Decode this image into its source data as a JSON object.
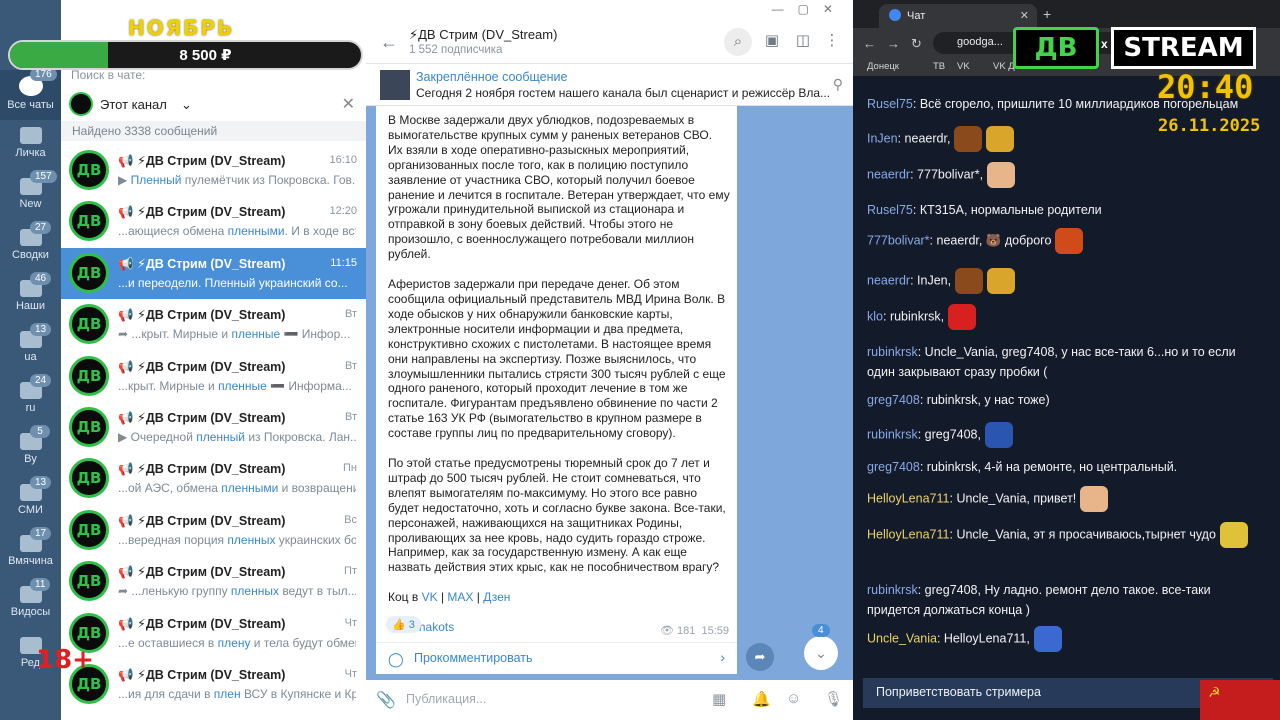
{
  "promo": {
    "month": "НОЯБРЬ",
    "amount": "8 500 ₽",
    "progress": 0.28
  },
  "age_badge": "18+",
  "rail": [
    {
      "label": "Все чаты",
      "badge": "176"
    },
    {
      "label": "Личка",
      "badge": ""
    },
    {
      "label": "New",
      "badge": "157"
    },
    {
      "label": "Сводки",
      "badge": "27"
    },
    {
      "label": "Наши",
      "badge": "46"
    },
    {
      "label": "ua",
      "badge": "13"
    },
    {
      "label": "ru",
      "badge": "24"
    },
    {
      "label": "By",
      "badge": "5"
    },
    {
      "label": "СМИ",
      "badge": "13"
    },
    {
      "label": "Вмячина",
      "badge": "17"
    },
    {
      "label": "Видосы",
      "badge": "11"
    },
    {
      "label": "Ред",
      "badge": ""
    }
  ],
  "chatlist": {
    "search_label": "Поиск в чате:",
    "filter": "Этот канал",
    "found": "Найдено 3338 сообщений",
    "rows": [
      {
        "name": "📢 ⚡ДВ Стрим (DV_Stream)",
        "time": "16:10",
        "pre": "▶ ",
        "hl": "Пленный",
        "post": " пулемётчик из Покровска. Гов..."
      },
      {
        "name": "📢 ⚡ДВ Стрим (DV_Stream)",
        "time": "12:20",
        "pre": "...ающиеся обмена ",
        "hl": "пленными",
        "post": ". И в ходе вст..."
      },
      {
        "name": "📢 ⚡ДВ Стрим (DV_Stream)",
        "time": "11:15",
        "pre": "...и переодели. ",
        "hl": "Пленный",
        "post": " украинский со..."
      },
      {
        "name": "📢 ⚡ДВ Стрим (DV_Stream)",
        "time": "Вт",
        "pre": "➦ ...крыт. Мирные и ",
        "hl": "пленные",
        "post": " ➖ Инфор..."
      },
      {
        "name": "📢 ⚡ДВ Стрим (DV_Stream)",
        "time": "Вт",
        "pre": "...крыт. Мирные и ",
        "hl": "пленные",
        "post": " ➖ Информа..."
      },
      {
        "name": "📢 ⚡ДВ Стрим (DV_Stream)",
        "time": "Вт",
        "pre": "▶ Очередной ",
        "hl": "пленный",
        "post": " из Покровска. Лан..."
      },
      {
        "name": "📢 ⚡ДВ Стрим (DV_Stream)",
        "time": "Пн",
        "pre": "...ой АЭС, обмена ",
        "hl": "пленными",
        "post": " и возвращения..."
      },
      {
        "name": "📢 ⚡ДВ Стрим (DV_Stream)",
        "time": "Вс",
        "pre": "...вередная порция ",
        "hl": "пленных",
        "post": " украинских бое..."
      },
      {
        "name": "📢 ⚡ДВ Стрим (DV_Stream)",
        "time": "Пт",
        "pre": "➦ ...ленькую группу ",
        "hl": "пленных",
        "post": " ведут в тыл..."
      },
      {
        "name": "📢 ⚡ДВ Стрим (DV_Stream)",
        "time": "Чт",
        "pre": "...е оставшиеся в ",
        "hl": "плену",
        "post": " и тела будут обмене..."
      },
      {
        "name": "📢 ⚡ДВ Стрим (DV_Stream)",
        "time": "Чт",
        "pre": "...ия для сдачи в ",
        "hl": "плен",
        "post": " ВСУ в Купянске и Крас..."
      }
    ]
  },
  "channel": {
    "title": "⚡ДВ Стрим (DV_Stream)",
    "subscribers": "1 552 подписчика",
    "pinned_title": "Закреплённое сообщение",
    "pinned_text": "Сегодня 2 ноября гостем нашего канала был сценарист и режиссёр Вла...",
    "avatar_text": "ДВ"
  },
  "message": {
    "p1": "В Москве задержали двух ублюдков, подозреваемых в вымогательстве крупных сумм у раненых ветеранов СВО. Их взяли в ходе оперативно-разыскных мероприятий, организованных после того, как в полицию поступило заявление от участника СВО, который получил боевое ранение и лечится в госпитале. Ветеран утверждает, что ему угрожали принудительной выпиской из стационара и отправкой в зону боевых действий. Чтобы этого не произошло, с военнослужащего потребовали миллион рублей.",
    "p2": "Аферистов задержали при передаче денег. Об этом сообщила официальный представитель МВД Ирина Волк. В ходе обысков у них обнаружили банковские карты, электронные носители информации и два предмета, конструктивно схожих с пистолетами. В настоящее время они направлены на экспертизу. Позже выяснилось, что злоумышленники пытались стрясти 300 тысяч рублей с еще одного раненого, который проходит лечение в том же госпитале. Фигурантам предъявлено обвинение по части 2 статье 163 УК РФ (вымогательство в крупном размере в составе группы лиц по предварительному сговору).",
    "p3": "По этой статье предусмотрены тюремный срок до 7 лет и штраф до 500 тысяч рублей. Не стоит сомневаться, что влепят вымогателям по-максимуму. Но этого все равно будет недостаточно, хоть и согласно букве закона. Все-таки, персонажей, наживающихся на защитниках Родины, проливающих за нее кровь, надо судить гораздо строже. Например, как за государственную измену. А как еще назвать действия этих крыс, как не пособничеством врагу?",
    "links_prefix": "Коц в ",
    "link_vk": "VK",
    "link_max": "MAX",
    "link_dzen": "Дзен",
    "signature": "@sashakots",
    "reaction": "👍 3",
    "views": "181",
    "time": "15:59",
    "comment": "Прокомментировать",
    "unread": "4"
  },
  "composer": {
    "placeholder": "Публикация..."
  },
  "browser": {
    "tab_title": "Чат",
    "url": "goodga...",
    "bookmarks": [
      "Донецк",
      "ТВ",
      "VK",
      "VK Д"
    ]
  },
  "stream": {
    "logo_left": "ДВ",
    "logo_x": "x",
    "logo_right": "STREAM",
    "clock": "20:40",
    "date": "26.11.2025"
  },
  "chat": [
    {
      "user": "Rusel75",
      "text": "Всё сгорело, пришлите 10 миллиардиков погорельцам",
      "emotes": []
    },
    {
      "user": "InJen",
      "text": "neaerdr,",
      "emotes": [
        "#8a4a1c",
        "#d9a52a"
      ]
    },
    {
      "user": "neaerdr",
      "text": "777bolivar*,",
      "emotes": [
        "#e8b48a"
      ]
    },
    {
      "user": "Rusel75",
      "text": "КТ315А, нормальные родители",
      "emotes": []
    },
    {
      "user": "777bolivar*",
      "text": "neaerdr, 🐻 доброго",
      "emotes": [
        "#d14a1a"
      ]
    },
    {
      "user": "neaerdr",
      "text": "InJen,",
      "emotes": [
        "#8a4a1c",
        "#d9a52a"
      ]
    },
    {
      "user": "klo",
      "text": "rubinkrsk,",
      "emotes": [
        "#d92020"
      ]
    },
    {
      "user": "rubinkrsk",
      "text": "Uncle_Vania, greg7408, у нас все-таки 6...но и то если один закрывают сразу пробки (",
      "emotes": []
    },
    {
      "user": "greg7408",
      "text": "rubinkrsk, у нас тоже)",
      "emotes": []
    },
    {
      "user": "rubinkrsk",
      "text": "greg7408,",
      "emotes": [
        "#2a55b0"
      ]
    },
    {
      "user": "greg7408",
      "text": "rubinkrsk, 4-й на ремонте, но центральный.",
      "emotes": []
    },
    {
      "user": "HelloyLena711",
      "text": "Uncle_Vania, привет!",
      "emotes": [
        "#e8b48a"
      ]
    },
    {
      "user": "HelloyLena711",
      "text": "Uncle_Vania, эт я просачиваюсь,тырнет чудо",
      "emotes": [
        "#e0c238"
      ]
    },
    {
      "user": "rubinkrsk",
      "text": "greg7408, Ну ладно. ремонт дело такое. все-таки придется должаться конца )",
      "emotes": []
    },
    {
      "user": "Uncle_Vania",
      "text": "HelloyLena711,",
      "emotes": [
        "#3a6ad0"
      ]
    }
  ],
  "greet_button": "Поприветствовать стримера"
}
